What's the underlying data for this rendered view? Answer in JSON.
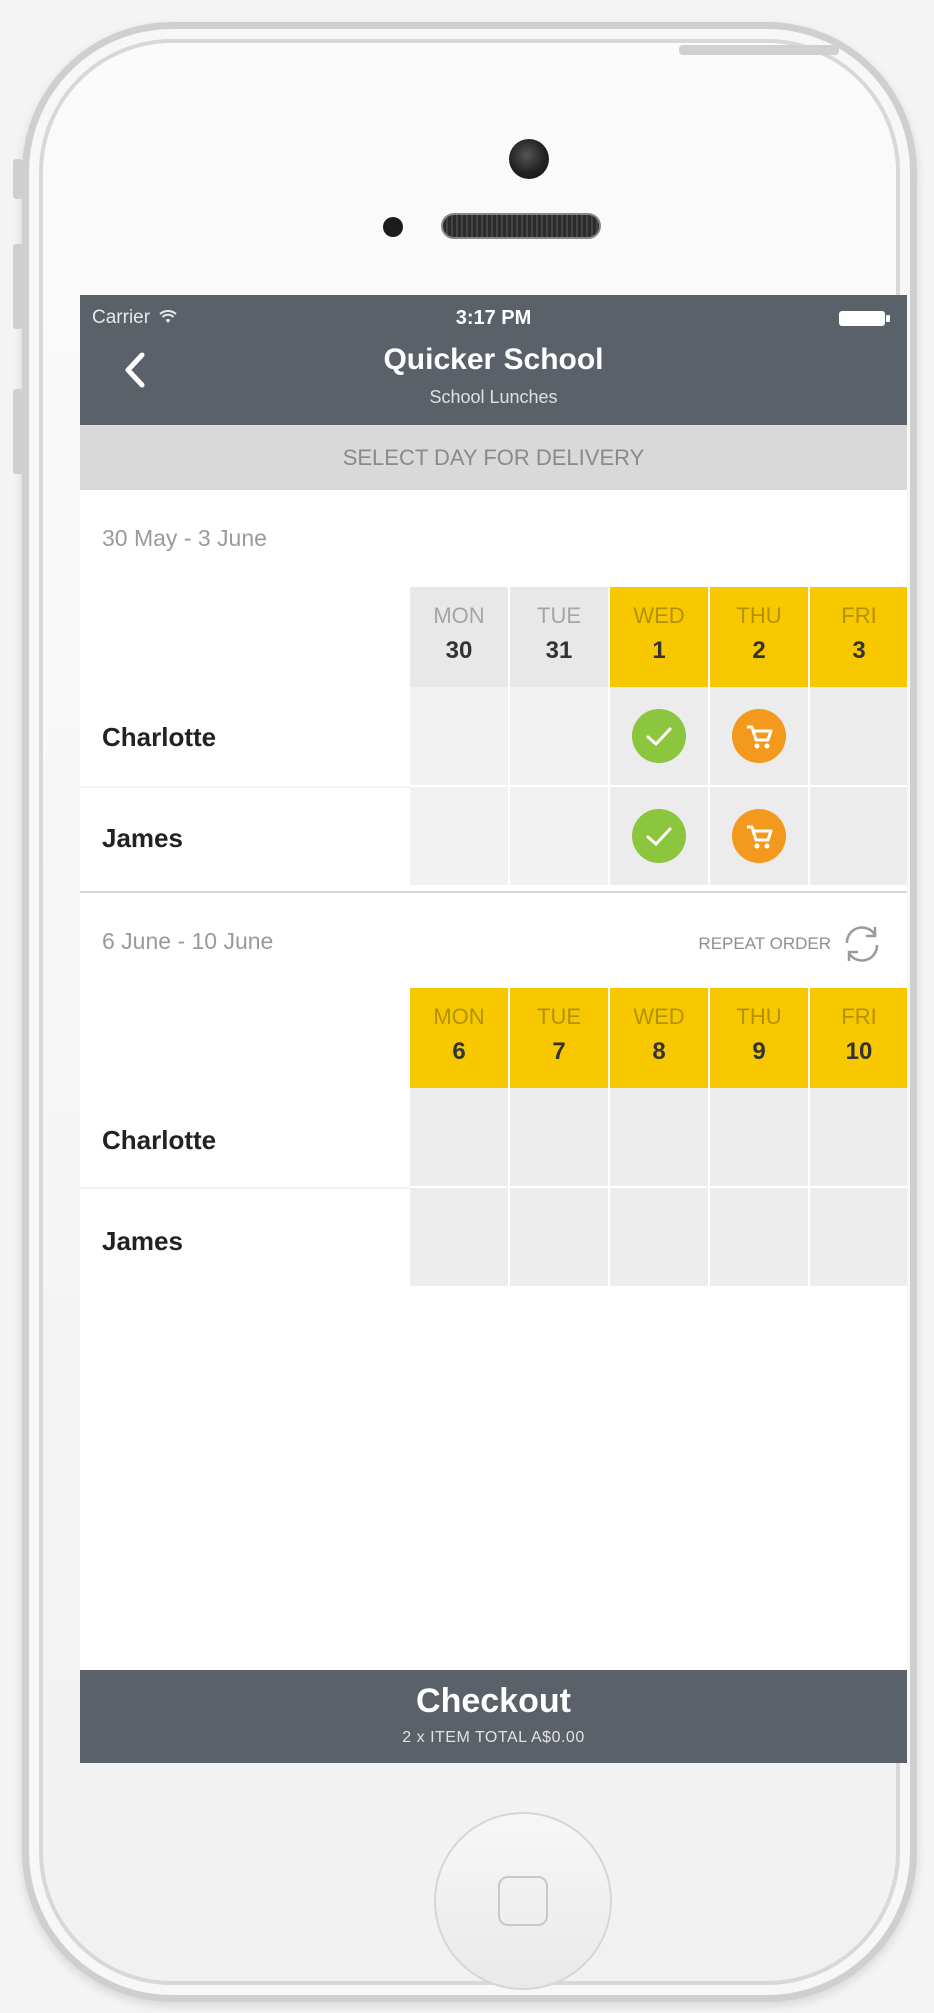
{
  "status": {
    "carrier": "Carrier",
    "time": "3:17 PM"
  },
  "nav": {
    "title": "Quicker School",
    "subtitle": "School Lunches"
  },
  "select_header": "SELECT DAY FOR DELIVERY",
  "weeks": [
    {
      "range": "30 May - 3 June",
      "days": [
        {
          "name": "MON",
          "date": "30",
          "state": "past"
        },
        {
          "name": "TUE",
          "date": "31",
          "state": "past"
        },
        {
          "name": "WED",
          "date": "1",
          "state": "available"
        },
        {
          "name": "THU",
          "date": "2",
          "state": "available"
        },
        {
          "name": "FRI",
          "date": "3",
          "state": "available"
        }
      ],
      "rows": [
        {
          "child": "Charlotte",
          "cells": [
            "",
            "",
            "ordered",
            "cart",
            ""
          ]
        },
        {
          "child": "James",
          "cells": [
            "",
            "",
            "ordered",
            "cart",
            ""
          ]
        }
      ]
    },
    {
      "range": "6 June - 10 June",
      "repeat_label": "REPEAT ORDER",
      "days": [
        {
          "name": "MON",
          "date": "6",
          "state": "available"
        },
        {
          "name": "TUE",
          "date": "7",
          "state": "available"
        },
        {
          "name": "WED",
          "date": "8",
          "state": "available"
        },
        {
          "name": "THU",
          "date": "9",
          "state": "available"
        },
        {
          "name": "FRI",
          "date": "10",
          "state": "available"
        }
      ],
      "rows": [
        {
          "child": "Charlotte",
          "cells": [
            "",
            "",
            "",
            "",
            ""
          ]
        },
        {
          "child": "James",
          "cells": [
            "",
            "",
            "",
            "",
            ""
          ]
        }
      ]
    }
  ],
  "checkout": {
    "label": "Checkout",
    "summary": "2 x ITEM  TOTAL A$0.00"
  },
  "colors": {
    "nav": "#5b6168",
    "accent_yellow": "#f7c800",
    "ordered_green": "#8cc63f",
    "cart_orange": "#f39a1e"
  },
  "icons": {
    "back": "chevron-left-icon",
    "ordered": "check-circle-icon",
    "cart": "cart-circle-icon",
    "repeat": "refresh-icon"
  }
}
